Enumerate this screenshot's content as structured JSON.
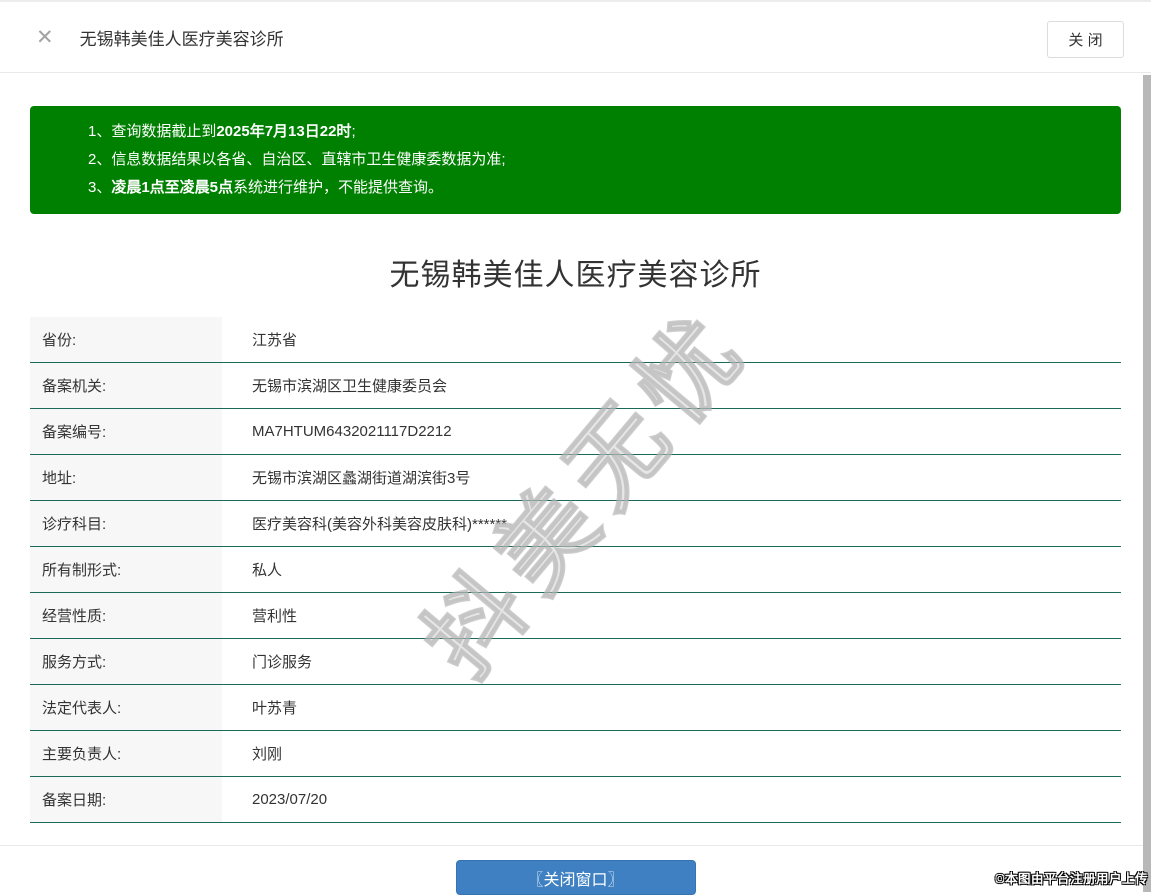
{
  "header": {
    "close_icon": "✕",
    "title": "无锡韩美佳人医疗美容诊所",
    "close_button_label": "关 闭"
  },
  "notice": {
    "background_color": "#008000",
    "lines": [
      {
        "pre": "1、查询数据截止到",
        "bold": "2025年7月13日22时",
        "post": ";"
      },
      {
        "pre": "2、信息数据结果以各省、自治区、直辖市卫生健康委数据为准;",
        "bold": "",
        "post": ""
      },
      {
        "pre": "3、",
        "bold": "凌晨1点至凌晨5点",
        "post": "系统进行维护，不能提供查询。"
      }
    ]
  },
  "main": {
    "title": "无锡韩美佳人医疗美容诊所",
    "table": {
      "divider_color": "#1b6a59",
      "rows": [
        {
          "label": "省份:",
          "value": "江苏省"
        },
        {
          "label": "备案机关:",
          "value": "无锡市滨湖区卫生健康委员会"
        },
        {
          "label": "备案编号:",
          "value": "MA7HTUM6432021117D2212"
        },
        {
          "label": "地址:",
          "value": "无锡市滨湖区蠡湖街道湖滨街3号"
        },
        {
          "label": "诊疗科目:",
          "value": "医疗美容科(美容外科美容皮肤科)******"
        },
        {
          "label": "所有制形式:",
          "value": "私人"
        },
        {
          "label": "经营性质:",
          "value": "营利性"
        },
        {
          "label": "服务方式:",
          "value": "门诊服务"
        },
        {
          "label": "法定代表人:",
          "value": "叶苏青"
        },
        {
          "label": "主要负责人:",
          "value": "刘刚"
        },
        {
          "label": "备案日期:",
          "value": "2023/07/20"
        }
      ]
    }
  },
  "footer": {
    "close_window_button_label": "〖关闭窗口〗",
    "button_color": "#3e80c2"
  },
  "watermark": {
    "text": "抖美无忧"
  },
  "overlay": {
    "copyright": "©本图由平台注册用户上传"
  }
}
